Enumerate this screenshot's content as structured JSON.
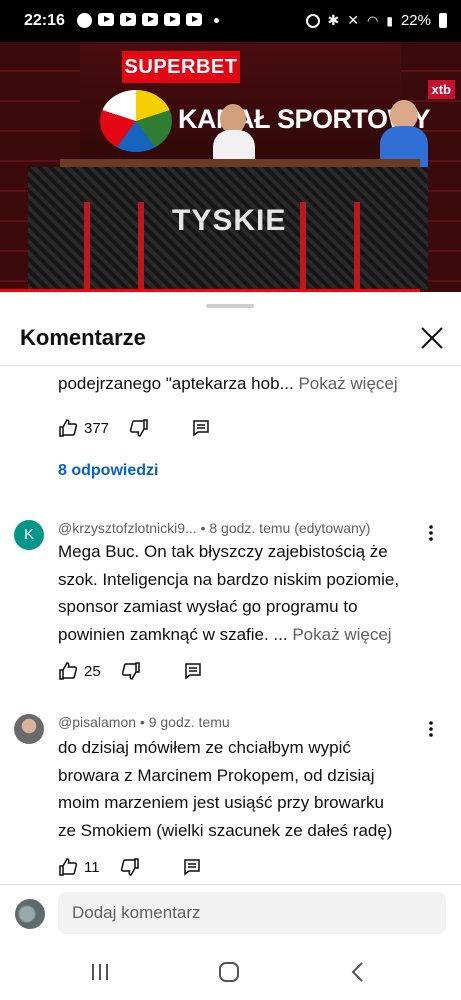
{
  "status_bar": {
    "time": "22:16",
    "battery": "22%",
    "app_icons": [
      "facebook-icon",
      "youtube-icon",
      "youtube-icon",
      "youtube-icon",
      "youtube-icon",
      "youtube-icon"
    ],
    "system_icons": [
      "alarm-icon",
      "bluetooth-icon",
      "mute-icon",
      "wifi-icon",
      "signal-icon",
      "battery-icon"
    ]
  },
  "video": {
    "sponsor_sign": "SUPERBET",
    "show_sign": "KANAŁ SPORTOWY",
    "desk_sign": "TYSKIE",
    "corner_sign": "xtb",
    "progress": 0.91,
    "accent_color": "#ff0000"
  },
  "sheet": {
    "title": "Komentarze",
    "close_icon": "close-icon"
  },
  "comments": [
    {
      "partial_text": "podejrzanego \"aptekarza hob...",
      "more_label": "Pokaż więcej",
      "likes": "377",
      "replies_label": "8 odpowiedzi"
    },
    {
      "avatar_letter": "K",
      "author": "@krzysztofzlotnicki9...",
      "time": "• 8 godz. temu (edytowany)",
      "lines": [
        "Mega Buc. On tak błyszczy zajebistością że",
        "szok. Inteligencja na bardzo niskim poziomie,",
        "sponsor zamiast wysłać go programu to",
        "powinien zamknąć w szafie. ..."
      ],
      "more_label": "Pokaż więcej",
      "likes": "25"
    },
    {
      "author": "@pisalamon",
      "time": "• 9 godz. temu",
      "lines": [
        "do dzisiaj mówiłem ze chciałbym wypić",
        "browara z Marcinem Prokopem, od dzisiaj",
        "moim marzeniem jest usiąść przy browarku",
        "ze Smokiem (wielki szacunek ze dałeś radę)"
      ],
      "likes": "11"
    }
  ],
  "add_comment": {
    "placeholder": "Dodaj komentarz"
  },
  "navigation": [
    "recent-apps-icon",
    "home-icon",
    "back-icon"
  ],
  "colors": {
    "link_blue": "#065fd4",
    "superbet_red": "#e30613",
    "avatar_teal": "#009688"
  }
}
